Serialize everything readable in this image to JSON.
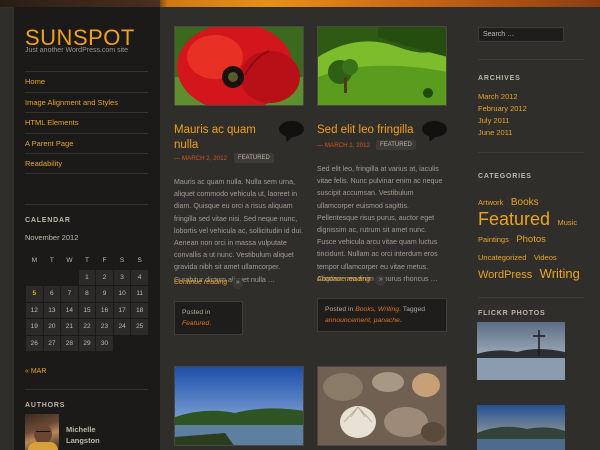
{
  "site": {
    "title": "SUNSPOT",
    "tagline": "Just another WordPress.com site"
  },
  "nav": [
    "Home",
    "Image Alignment and Styles",
    "HTML Elements",
    "A Parent Page",
    "Readability"
  ],
  "calendar": {
    "title": "CALENDAR",
    "month": "November 2012",
    "weekdays": [
      "M",
      "T",
      "W",
      "T",
      "F",
      "S",
      "S"
    ],
    "rows": [
      [
        "",
        "",
        "",
        "1",
        "2",
        "3",
        "4"
      ],
      [
        "5",
        "6",
        "7",
        "8",
        "9",
        "10",
        "11"
      ],
      [
        "12",
        "13",
        "14",
        "15",
        "16",
        "17",
        "18"
      ],
      [
        "19",
        "20",
        "21",
        "22",
        "23",
        "24",
        "25"
      ],
      [
        "26",
        "27",
        "28",
        "29",
        "30",
        "",
        ""
      ]
    ],
    "today": "5",
    "prev_link": "« MAR"
  },
  "authors": {
    "title": "AUTHORS",
    "name": "Michelle Langston"
  },
  "posts": [
    {
      "title": "Mauris ac quam nulla",
      "date": "— MARCH 2, 2012",
      "tag": "FEATURED",
      "excerpt": "Mauris ac quam nulla. Nulla sem urna, aliquet commodo vehicula ut, laoreet in diam. Quisque eu orci a risus aliquam fringilla sed vitae nisi. Sed neque nunc, lobortis vel vehicula ac, sollicitudin id dui. Aenean non orci in massa vulputate convallis a ut nunc. Vestibulum aliquet gravida nibh sit amet ullamcorper. Curabitur dictum aliquet nulla …",
      "more": "Continue reading",
      "posted_prefix": "Posted in",
      "posted_cats": "Featured",
      "posted_suffix": "."
    },
    {
      "title": "Sed elit leo fringilla",
      "date": "— MARCH 1, 2012",
      "tag": "FEATURED",
      "excerpt": "Sed elit leo, fringilla at varius at, iaculis vitae felis. Nunc pulvinar enim ac neque suscipit accumsan. Vestibulum ullamcorper euismod sagittis. Pellentesque risus purus, auctor eget dignissim ac, rutrum sit amet nunc. Fusce vehicula arcu vitae quam luctus tincidunt. Nullam ac orci interdum eros tempor ullamcorper eu vitae metus. Aliquam non enim ut purus rhoncus …",
      "more": "Continue reading",
      "posted_prefix": "Posted in",
      "posted_cats": "Books, Writing",
      "posted_mid": ". Tagged",
      "posted_tags": "announcement, panache",
      "posted_suffix": "."
    }
  ],
  "search": {
    "placeholder": "Search …"
  },
  "archives": {
    "title": "ARCHIVES",
    "items": [
      "March 2012",
      "February 2012",
      "July 2011",
      "June 2011"
    ]
  },
  "categories": {
    "title": "CATEGORIES",
    "tags": [
      "Artwork",
      "Books",
      "Featured",
      "Music",
      "Paintings",
      "Photos",
      "Uncategorized",
      "Videos",
      "WordPress",
      "Writing"
    ]
  },
  "flickr": {
    "title": "FLICKR PHOTOS"
  },
  "colors": {
    "accent": "#f0a11c",
    "link": "#e8a526",
    "date": "#d0541e",
    "background": "#302e2b",
    "sidebar": "#1b1a18"
  }
}
